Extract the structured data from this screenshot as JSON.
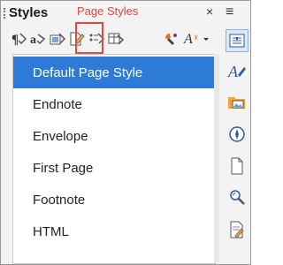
{
  "panel": {
    "title": "Styles",
    "annotation": "Page Styles",
    "close_glyph": "×",
    "menu_glyph": "≡",
    "annotation_color": "#e8453c"
  },
  "toolbar": {
    "buttons": [
      {
        "name": "paragraph-styles-icon"
      },
      {
        "name": "character-styles-icon"
      },
      {
        "name": "frame-styles-icon"
      },
      {
        "name": "page-styles-icon",
        "highlighted": true
      },
      {
        "name": "list-styles-icon"
      },
      {
        "name": "table-styles-icon"
      },
      {
        "name": "fill-format-mode-icon"
      },
      {
        "name": "styles-actions-icon"
      }
    ]
  },
  "styles_list": {
    "items": [
      {
        "label": "Default Page Style",
        "selected": true
      },
      {
        "label": "Endnote"
      },
      {
        "label": "Envelope"
      },
      {
        "label": "First Page"
      },
      {
        "label": "Footnote"
      },
      {
        "label": "HTML"
      }
    ],
    "selection_color": "#2d7bd6"
  },
  "sidebar_deck": {
    "buttons": [
      {
        "name": "properties-icon",
        "active": true
      },
      {
        "name": "styles-deck-icon"
      },
      {
        "name": "gallery-icon"
      },
      {
        "name": "navigator-icon"
      },
      {
        "name": "page-deck-icon"
      },
      {
        "name": "style-inspector-icon"
      },
      {
        "name": "manage-changes-icon"
      }
    ]
  }
}
